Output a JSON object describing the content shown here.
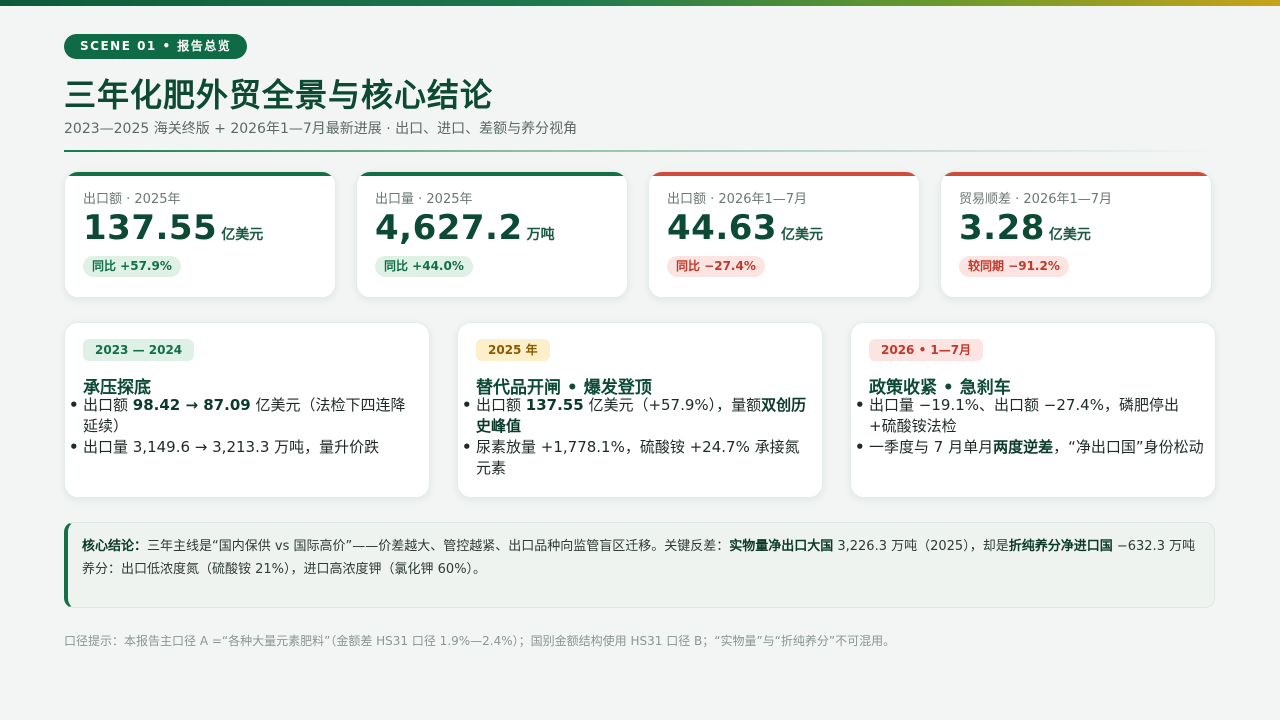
{
  "scene_tag": "SCENE 01 • 报告总览",
  "title": "三年化肥外贸全景与核心结论",
  "subtitle": "2023—2025 海关终版 + 2026年1—7月最新进展 · 出口、进口、差额与养分视角",
  "colors": {
    "accent_green": "#0f6b45",
    "accent_red": "#d04a3a",
    "title": "#0c4a33"
  },
  "kpis": [
    {
      "label": "出口额 · 2025年",
      "value": "137.55",
      "unit": "亿美元",
      "badge": "同比 +57.9%",
      "tone": "green"
    },
    {
      "label": "出口量 · 2025年",
      "value": "4,627.2",
      "unit": "万吨",
      "badge": "同比 +44.0%",
      "tone": "green"
    },
    {
      "label": "出口额 · 2026年1—7月",
      "value": "44.63",
      "unit": "亿美元",
      "badge": "同比 −27.4%",
      "tone": "red"
    },
    {
      "label": "贸易顺差 · 2026年1—7月",
      "value": "3.28",
      "unit": "亿美元",
      "badge": "较同期 −91.2%",
      "tone": "red"
    }
  ],
  "phases": [
    {
      "tag": "2023 — 2024",
      "title": "承压探底",
      "bullets": [
        {
          "pre": "出口额 ",
          "bold": "98.42 → 87.09",
          "post": " 亿美元（法检下四连降延续）"
        },
        {
          "pre": "出口量 3,149.6 → 3,213.3 万吨，量升价跌",
          "bold": "",
          "post": ""
        }
      ]
    },
    {
      "tag": "2025 年",
      "title": "替代品开闸 • 爆发登顶",
      "bullets": [
        {
          "pre": "出口额 ",
          "bold": "137.55",
          "post": " 亿美元（+57.9%），量额",
          "bold2": "双创历史峰值"
        },
        {
          "pre": "尿素放量 +1,778.1%，硫酸铵 +24.7% 承接氮元素",
          "bold": "",
          "post": ""
        }
      ]
    },
    {
      "tag": "2026 • 1—7月",
      "title": "政策收紧 • 急刹车",
      "bullets": [
        {
          "pre": "出口量 −19.1%、出口额 −27.4%，磷肥停出 +硫酸铵法检",
          "bold": "",
          "post": ""
        },
        {
          "pre": "一季度与 7 月单月",
          "bold": "两度逆差",
          "post": "，“净出口国”身份松动"
        }
      ]
    }
  ],
  "conclusion": {
    "label": "核心结论：",
    "t1": "三年主线是“国内保供 vs 国际高价”——价差越大、管控越紧、出口品种向监管盲区迁移。关键反差：",
    "b1": "实物量净出口大国",
    "t2": " 3,226.3 万吨（2025），却是",
    "b2": "折纯养分净进口国",
    "t3": " −632.3 万吨养分：出口低浓度氮（硫酸铵 21%），进口高浓度钾（氯化钾 60%）。"
  },
  "footnote": "口径提示：本报告主口径 A =“各种大量元素肥料”（金额差 HS31 口径 1.9%—2.4%）；国别金额结构使用 HS31 口径 B；“实物量”与“折纯养分”不可混用。"
}
